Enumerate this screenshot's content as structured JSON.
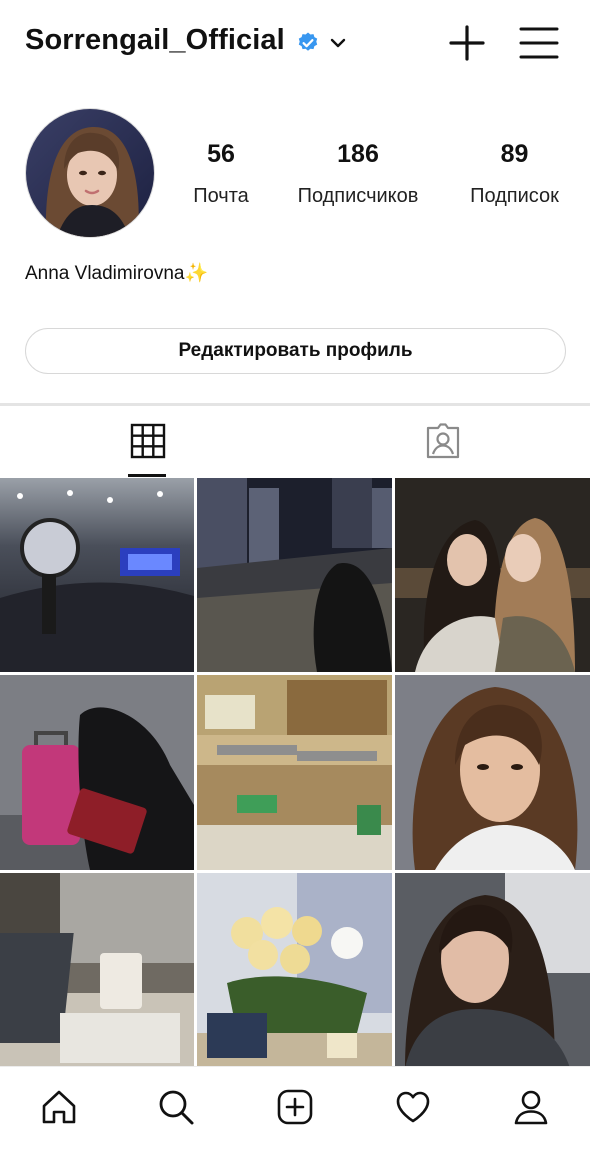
{
  "header": {
    "username": "Sorrengail_Official",
    "verified_icon": "verified-badge-icon",
    "accent_color": "#3897f0"
  },
  "profile": {
    "full_name": "Anna Vladimirovna✨",
    "stats": [
      {
        "value": "56",
        "label": "Почта"
      },
      {
        "value": "186",
        "label": "Подписчиков"
      },
      {
        "value": "89",
        "label": "Подписок"
      }
    ],
    "edit_button_label": "Редактировать профиль"
  },
  "tabs": [
    {
      "icon": "grid-icon",
      "active": true
    },
    {
      "icon": "tagged-icon",
      "active": false
    }
  ],
  "posts": [
    {
      "alt": "concert-photo"
    },
    {
      "alt": "night-city-river-photo"
    },
    {
      "alt": "friends-night-photo"
    },
    {
      "alt": "airport-suitcase-passport-photo"
    },
    {
      "alt": "classroom-photo"
    },
    {
      "alt": "portrait-selfie-photo"
    },
    {
      "alt": "laptop-coffee-photo"
    },
    {
      "alt": "flowers-bouquet-photo"
    },
    {
      "alt": "car-selfie-photo"
    }
  ],
  "bottom_nav": [
    "home-icon",
    "search-icon",
    "add-post-icon",
    "heart-icon",
    "profile-icon"
  ]
}
